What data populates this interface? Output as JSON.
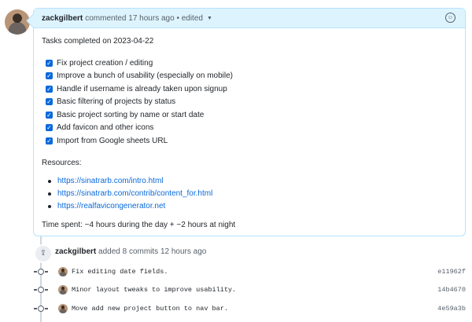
{
  "comment": {
    "author": "zackgilbert",
    "action": "commented 17 hours ago",
    "edited": "• edited",
    "date_line": "Tasks completed on 2023-04-22",
    "tasks": [
      "Fix project creation / editing",
      "Improve a bunch of usability (especially on mobile)",
      "Handle if username is already taken upon signup",
      "Basic filtering of projects by status",
      "Basic project sorting by name or start date",
      "Add favicon and other icons",
      "Import from Google sheets URL"
    ],
    "resources_label": "Resources:",
    "links": [
      "https://sinatrarb.com/intro.html",
      "https://sinatrarb.com/contrib/content_for.html",
      "https://realfavicongenerator.net"
    ],
    "time_spent": "Time spent: ~4 hours during the day + ~2 hours at night"
  },
  "event": {
    "author": "zackgilbert",
    "text": "added 8 commits 12 hours ago"
  },
  "commits": [
    {
      "message": "Fix editing date fields.",
      "sha": "e11962f"
    },
    {
      "message": "Minor layout tweaks to improve usability.",
      "sha": "14b4670"
    },
    {
      "message": "Move add new project button to nav bar.",
      "sha": "4e59a3b"
    }
  ]
}
